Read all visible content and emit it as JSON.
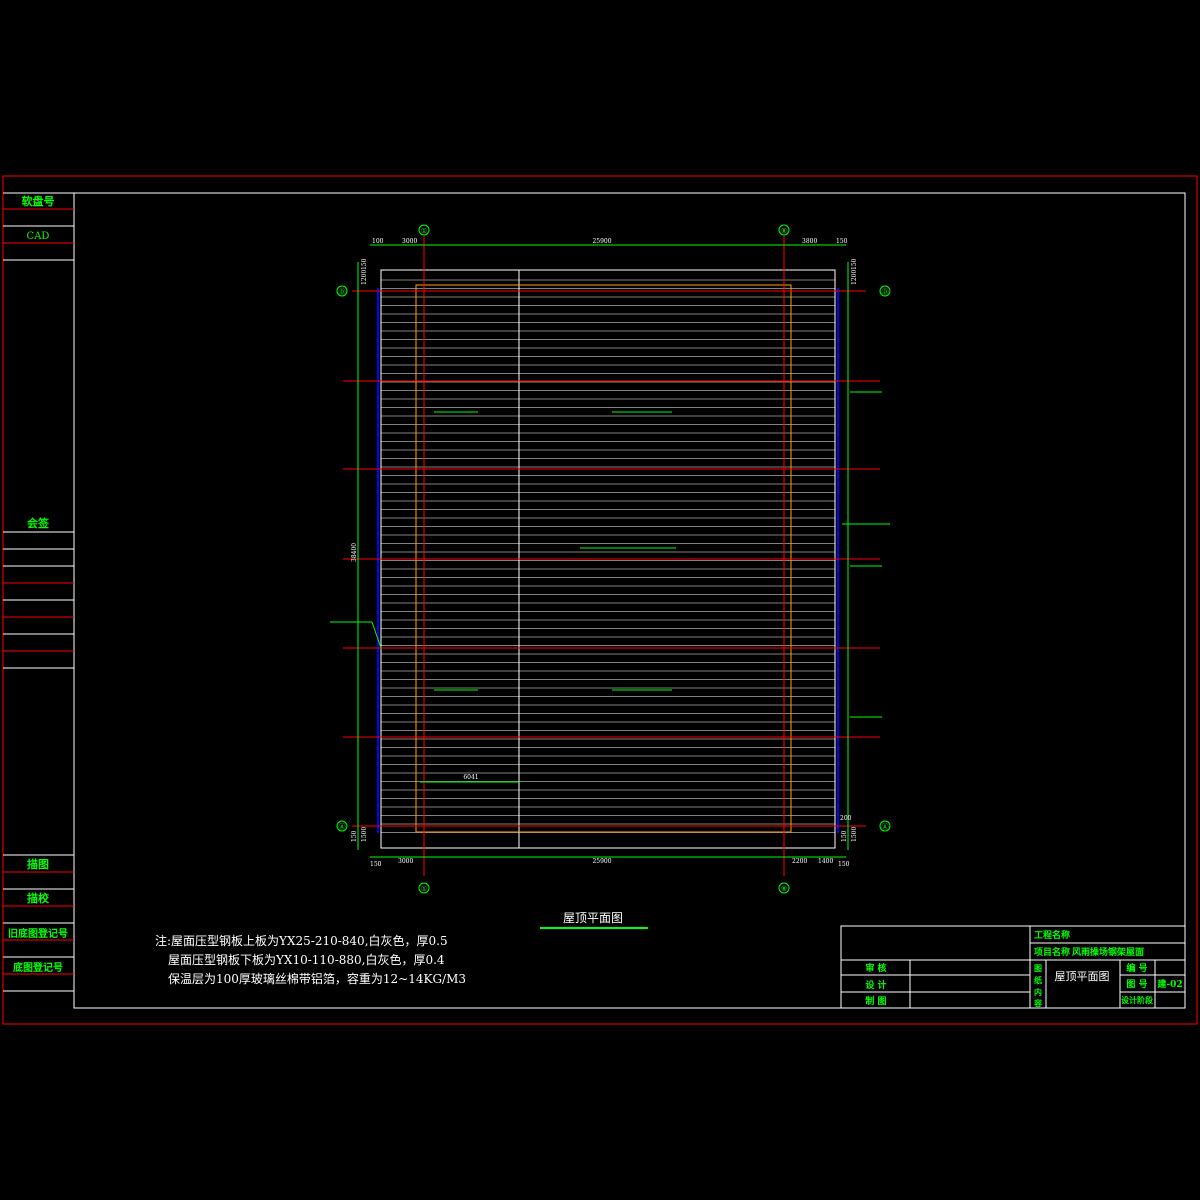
{
  "sidebar": {
    "disk_no_label": "软盘号",
    "cad_label": "CAD",
    "countersign_label": "会签",
    "drawn_label": "描图",
    "traced_check_label": "描校",
    "old_register_label": "旧底图登记号",
    "base_register_label": "底图登记号"
  },
  "plan": {
    "title": "屋顶平面图",
    "top_dims": [
      "100",
      "3000",
      "25900",
      "3800",
      "150"
    ],
    "bottom_dims": [
      "150",
      "3000",
      "25900",
      "2200",
      "1400",
      "150"
    ],
    "left_dims": [
      "150",
      "1200",
      "38400",
      "1500",
      "150"
    ],
    "right_dims": [
      "150",
      "1200",
      "1500",
      "200",
      "150"
    ],
    "span_label": "6041",
    "axis_top_left": "①",
    "axis_top_right": "⑧",
    "axis_left_top": "Ⓓ",
    "axis_left_bottom": "Ⓐ",
    "axis_right_top": "Ⓓ",
    "axis_right_bottom": "Ⓐ"
  },
  "notes": {
    "line1": "注:屋面压型钢板上板为YX25-210-840,白灰色，厚0.5",
    "line2": "屋面压型钢板下板为YX10-110-880,白灰色，厚0.4",
    "line3": "保温层为100厚玻璃丝棉带铝箔，容重为12~14KG/M3"
  },
  "titleblock": {
    "project_name_label": "工程名称",
    "item_name_label": "项目名称",
    "item_name_value": "风雨操场钢架屋面",
    "review_label": "审 核",
    "design_label": "设 计",
    "draw_label": "制 图",
    "content_label_1": "图",
    "content_label_2": "纸",
    "content_label_3": "内",
    "content_label_4": "容",
    "drawing_title": "屋顶平面图",
    "sheet_no_label": "编 号",
    "drawing_no_label": "图 号",
    "drawing_no_value": "建-02",
    "design_stage_label": "设计阶段"
  },
  "colors": {
    "frame": "#ff0000",
    "text": "#00ff00",
    "panel_lines": "#ffffff",
    "edge_lines": "#0000ff",
    "ridge": "#ffa500"
  }
}
